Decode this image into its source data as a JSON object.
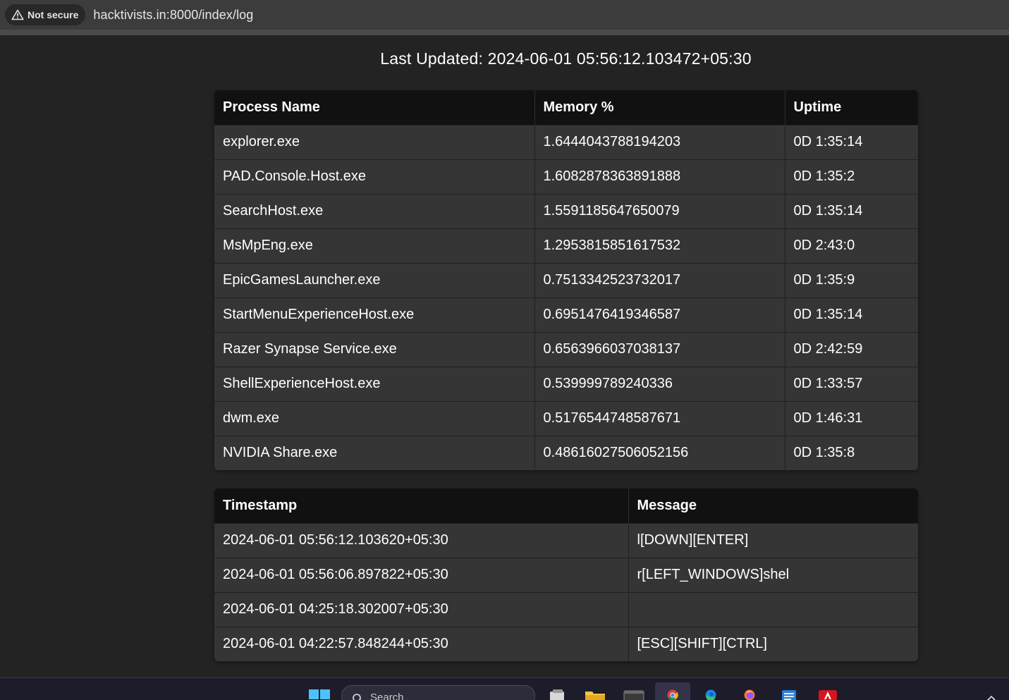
{
  "browser": {
    "security_label": "Not secure",
    "url": "hacktivists.in:8000/index/log"
  },
  "page": {
    "last_updated": "Last Updated: 2024-06-01 05:56:12.103472+05:30"
  },
  "process_table": {
    "headers": [
      "Process Name",
      "Memory %",
      "Uptime"
    ],
    "rows": [
      [
        "explorer.exe",
        "1.6444043788194203",
        "0D 1:35:14"
      ],
      [
        "PAD.Console.Host.exe",
        "1.6082878363891888",
        "0D 1:35:2"
      ],
      [
        "SearchHost.exe",
        "1.5591185647650079",
        "0D 1:35:14"
      ],
      [
        "MsMpEng.exe",
        "1.2953815851617532",
        "0D 2:43:0"
      ],
      [
        "EpicGamesLauncher.exe",
        "0.7513342523732017",
        "0D 1:35:9"
      ],
      [
        "StartMenuExperienceHost.exe",
        "0.6951476419346587",
        "0D 1:35:14"
      ],
      [
        "Razer Synapse Service.exe",
        "0.6563966037038137",
        "0D 2:42:59"
      ],
      [
        "ShellExperienceHost.exe",
        "0.539999789240336",
        "0D 1:33:57"
      ],
      [
        "dwm.exe",
        "0.5176544748587671",
        "0D 1:46:31"
      ],
      [
        "NVIDIA Share.exe",
        "0.48616027506052156",
        "0D 1:35:8"
      ]
    ]
  },
  "log_table": {
    "headers": [
      "Timestamp",
      "Message"
    ],
    "rows": [
      [
        "2024-06-01 05:56:12.103620+05:30",
        "l[DOWN][ENTER]"
      ],
      [
        "2024-06-01 05:56:06.897822+05:30",
        "r[LEFT_WINDOWS]shel"
      ],
      [
        "2024-06-01 04:25:18.302007+05:30",
        ""
      ],
      [
        "2024-06-01 04:22:57.848244+05:30",
        "[ESC][SHIFT][CTRL]"
      ]
    ]
  },
  "taskbar": {
    "search_label": "Search",
    "icons": [
      "windows-start-icon",
      "search-icon",
      "task-view-icon",
      "file-explorer-icon",
      "terminal-icon",
      "chrome-icon",
      "edge-icon",
      "firefox-icon",
      "notepad-icon",
      "acrobat-icon",
      "chevron-up-icon"
    ]
  }
}
